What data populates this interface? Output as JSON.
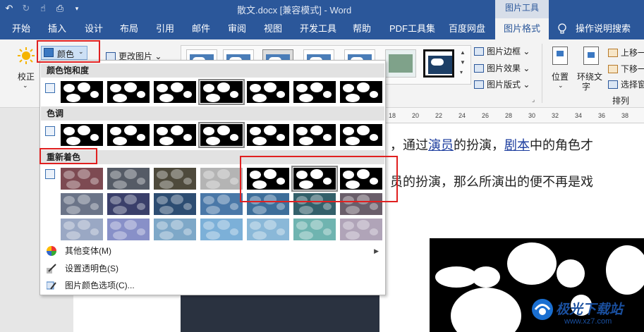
{
  "titlebar": {
    "title": "散文.docx [兼容模式] - Word",
    "context_tool": "图片工具",
    "qat": [
      "undo-icon",
      "redo-icon",
      "touch-mode-icon",
      "print-preview-icon",
      "customize-qat-icon"
    ]
  },
  "tabs": [
    {
      "label": "开始"
    },
    {
      "label": "插入"
    },
    {
      "label": "设计"
    },
    {
      "label": "布局"
    },
    {
      "label": "引用"
    },
    {
      "label": "邮件"
    },
    {
      "label": "审阅"
    },
    {
      "label": "视图"
    },
    {
      "label": "开发工具"
    },
    {
      "label": "帮助"
    },
    {
      "label": "PDF工具集"
    },
    {
      "label": "百度网盘"
    },
    {
      "label": "图片格式"
    }
  ],
  "tell_me": "操作说明搜索",
  "ribbon": {
    "corrections": "校正",
    "color": "颜色",
    "change_picture": "更改图片",
    "border": "图片边框",
    "effects": "图片效果",
    "layout": "图片版式",
    "position": "位置",
    "wrap_text_1": "环绕文",
    "wrap_text_2": "字",
    "bring_forward": "上移一",
    "send_backward": "下移一",
    "selection_pane": "选择窗",
    "arrange_group": "排列"
  },
  "ruler": [
    "18",
    "20",
    "22",
    "24",
    "26",
    "28",
    "30",
    "32",
    "34",
    "36",
    "38"
  ],
  "color_menu": {
    "saturation_header": "颜色饱和度",
    "tone_header": "色调",
    "recolor_header": "重新着色",
    "more_variations": "其他变体(M)",
    "set_transparent": "设置透明色(S)",
    "picture_color_options": "图片颜色选项(C)..."
  },
  "document": {
    "line1_a": "，通过",
    "line1_link1": "演员",
    "line1_b": "的扮演，",
    "line1_link2": "剧本",
    "line1_c": "中的角色才",
    "line2": "员的扮演，那么所演出的便不再是戏"
  },
  "watermark": {
    "main": "极光下载站",
    "url": "www.xz7.com"
  },
  "colors": {
    "word_blue": "#2b579a",
    "highlight_red": "#e02020",
    "link_blue": "#1b3c9e"
  }
}
